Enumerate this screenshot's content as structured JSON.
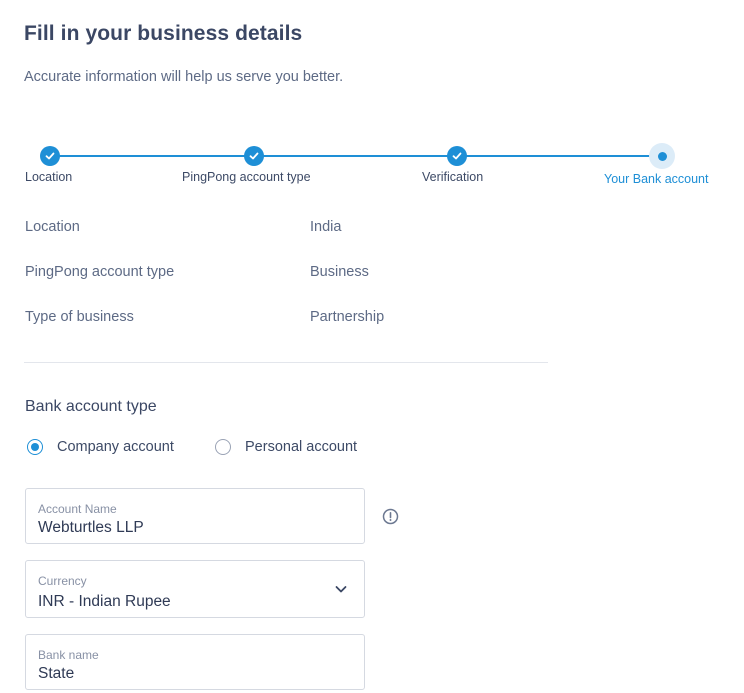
{
  "header": {
    "title": "Fill in your business details",
    "subtitle": "Accurate information will help us serve you better."
  },
  "stepper": {
    "steps": [
      {
        "label": "Location",
        "state": "done"
      },
      {
        "label": "PingPong account type",
        "state": "done"
      },
      {
        "label": "Verification",
        "state": "done"
      },
      {
        "label": "Your Bank account",
        "state": "current"
      }
    ]
  },
  "summary": {
    "rows": [
      {
        "label": "Location",
        "value": "India"
      },
      {
        "label": "PingPong account type",
        "value": "Business"
      },
      {
        "label": "Type of business",
        "value": "Partnership"
      }
    ]
  },
  "bank_account_type": {
    "title": "Bank account type",
    "options": [
      {
        "label": "Company account",
        "selected": true
      },
      {
        "label": "Personal account",
        "selected": false
      }
    ]
  },
  "form": {
    "account_name": {
      "label": "Account Name",
      "value": "Webturtles LLP"
    },
    "currency": {
      "label": "Currency",
      "value": "INR - Indian Rupee"
    },
    "bank_name": {
      "label": "Bank name",
      "value": "State"
    }
  },
  "colors": {
    "accent": "#1e8fd6",
    "text": "#3b4764",
    "muted": "#5d6a85",
    "border": "#d5d9e1"
  },
  "icons": {
    "check": "check-icon",
    "info": "info-icon",
    "chevron": "chevron-down-icon"
  }
}
